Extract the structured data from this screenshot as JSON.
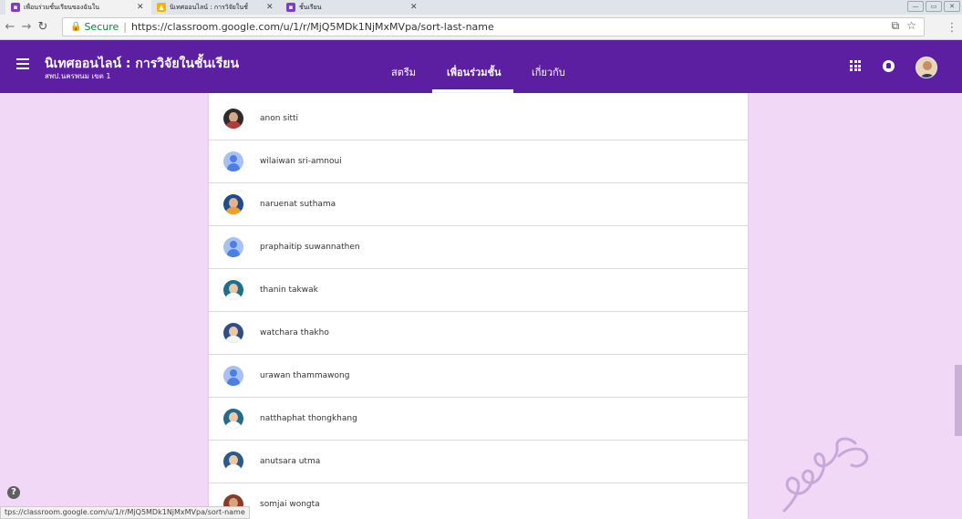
{
  "browser": {
    "tabs": [
      {
        "label": "เพื่อนร่วมชั้นเรียนของฉันใน",
        "icon": "classroom-tab-icon",
        "active": true
      },
      {
        "label": "นิเทศออนไลน์ : การวิจัยในชั้",
        "icon": "drive-tab-icon",
        "active": false
      },
      {
        "label": "ชั้นเรียน",
        "icon": "classroom-tab-icon",
        "active": false
      }
    ],
    "secure_label": "Secure",
    "url": "https://classroom.google.com/u/1/r/MjQ5MDk1NjMxMVpa/sort-last-name",
    "status_url": "tps://classroom.google.com/u/1/r/MjQ5MDk1NjMxMVpa/sort-name"
  },
  "header": {
    "class_title": "นิเทศออนไลน์ : การวิจัยในชั้นเรียน",
    "class_subtitle": "สพป.นครพนม เขต 1",
    "tabs": [
      {
        "label": "สตรีม",
        "active": false
      },
      {
        "label": "เพื่อนร่วมชั้น",
        "active": true
      },
      {
        "label": "เกี่ยวกับ",
        "active": false
      }
    ]
  },
  "students": [
    {
      "name": "anon sitti",
      "avatar": "photo"
    },
    {
      "name": "wilaiwan sri-amnoui",
      "avatar": "default"
    },
    {
      "name": "naruenat suthama",
      "avatar": "photo"
    },
    {
      "name": "praphaitip suwannathen",
      "avatar": "default"
    },
    {
      "name": "thanin takwak",
      "avatar": "photo"
    },
    {
      "name": "watchara thakho",
      "avatar": "photo"
    },
    {
      "name": "urawan thammawong",
      "avatar": "default"
    },
    {
      "name": "natthaphat thongkhang",
      "avatar": "photo"
    },
    {
      "name": "anutsara utma",
      "avatar": "photo"
    },
    {
      "name": "somjai wongta",
      "avatar": "photo"
    }
  ],
  "colors": {
    "header_bg": "#5c1fa2",
    "page_bg": "#f1d8f7",
    "secure_green": "#0b8043",
    "default_avatar_bg": "#a7c1f5"
  }
}
